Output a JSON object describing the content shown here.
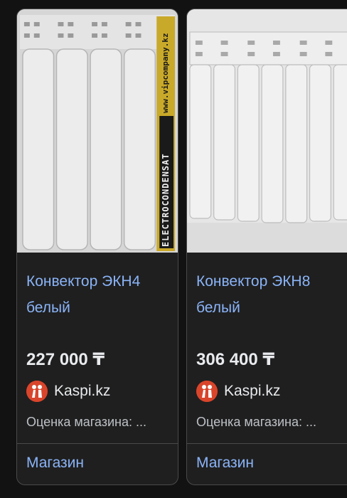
{
  "products": [
    {
      "title": "Конвектор ЭКН4\nбелый",
      "price": "227 000 ₸",
      "seller": "Kaspi.kz",
      "rating_label": "Оценка магазина: ...",
      "action_label": "Магазин",
      "image_brand_text": "ELECTROCONDENSAT",
      "image_url_text": "www.vipcompany.kz",
      "sections": 4
    },
    {
      "title": "Конвектор ЭКН8\nбелый",
      "price": "306 400 ₸",
      "seller": "Kaspi.kz",
      "rating_label": "Оценка магазина: ...",
      "action_label": "Магазин",
      "sections": 8
    }
  ],
  "colors": {
    "background": "#121212",
    "card": "#1f1f1f",
    "link": "#8ab4f8",
    "seller_logo": "#d9452b"
  }
}
